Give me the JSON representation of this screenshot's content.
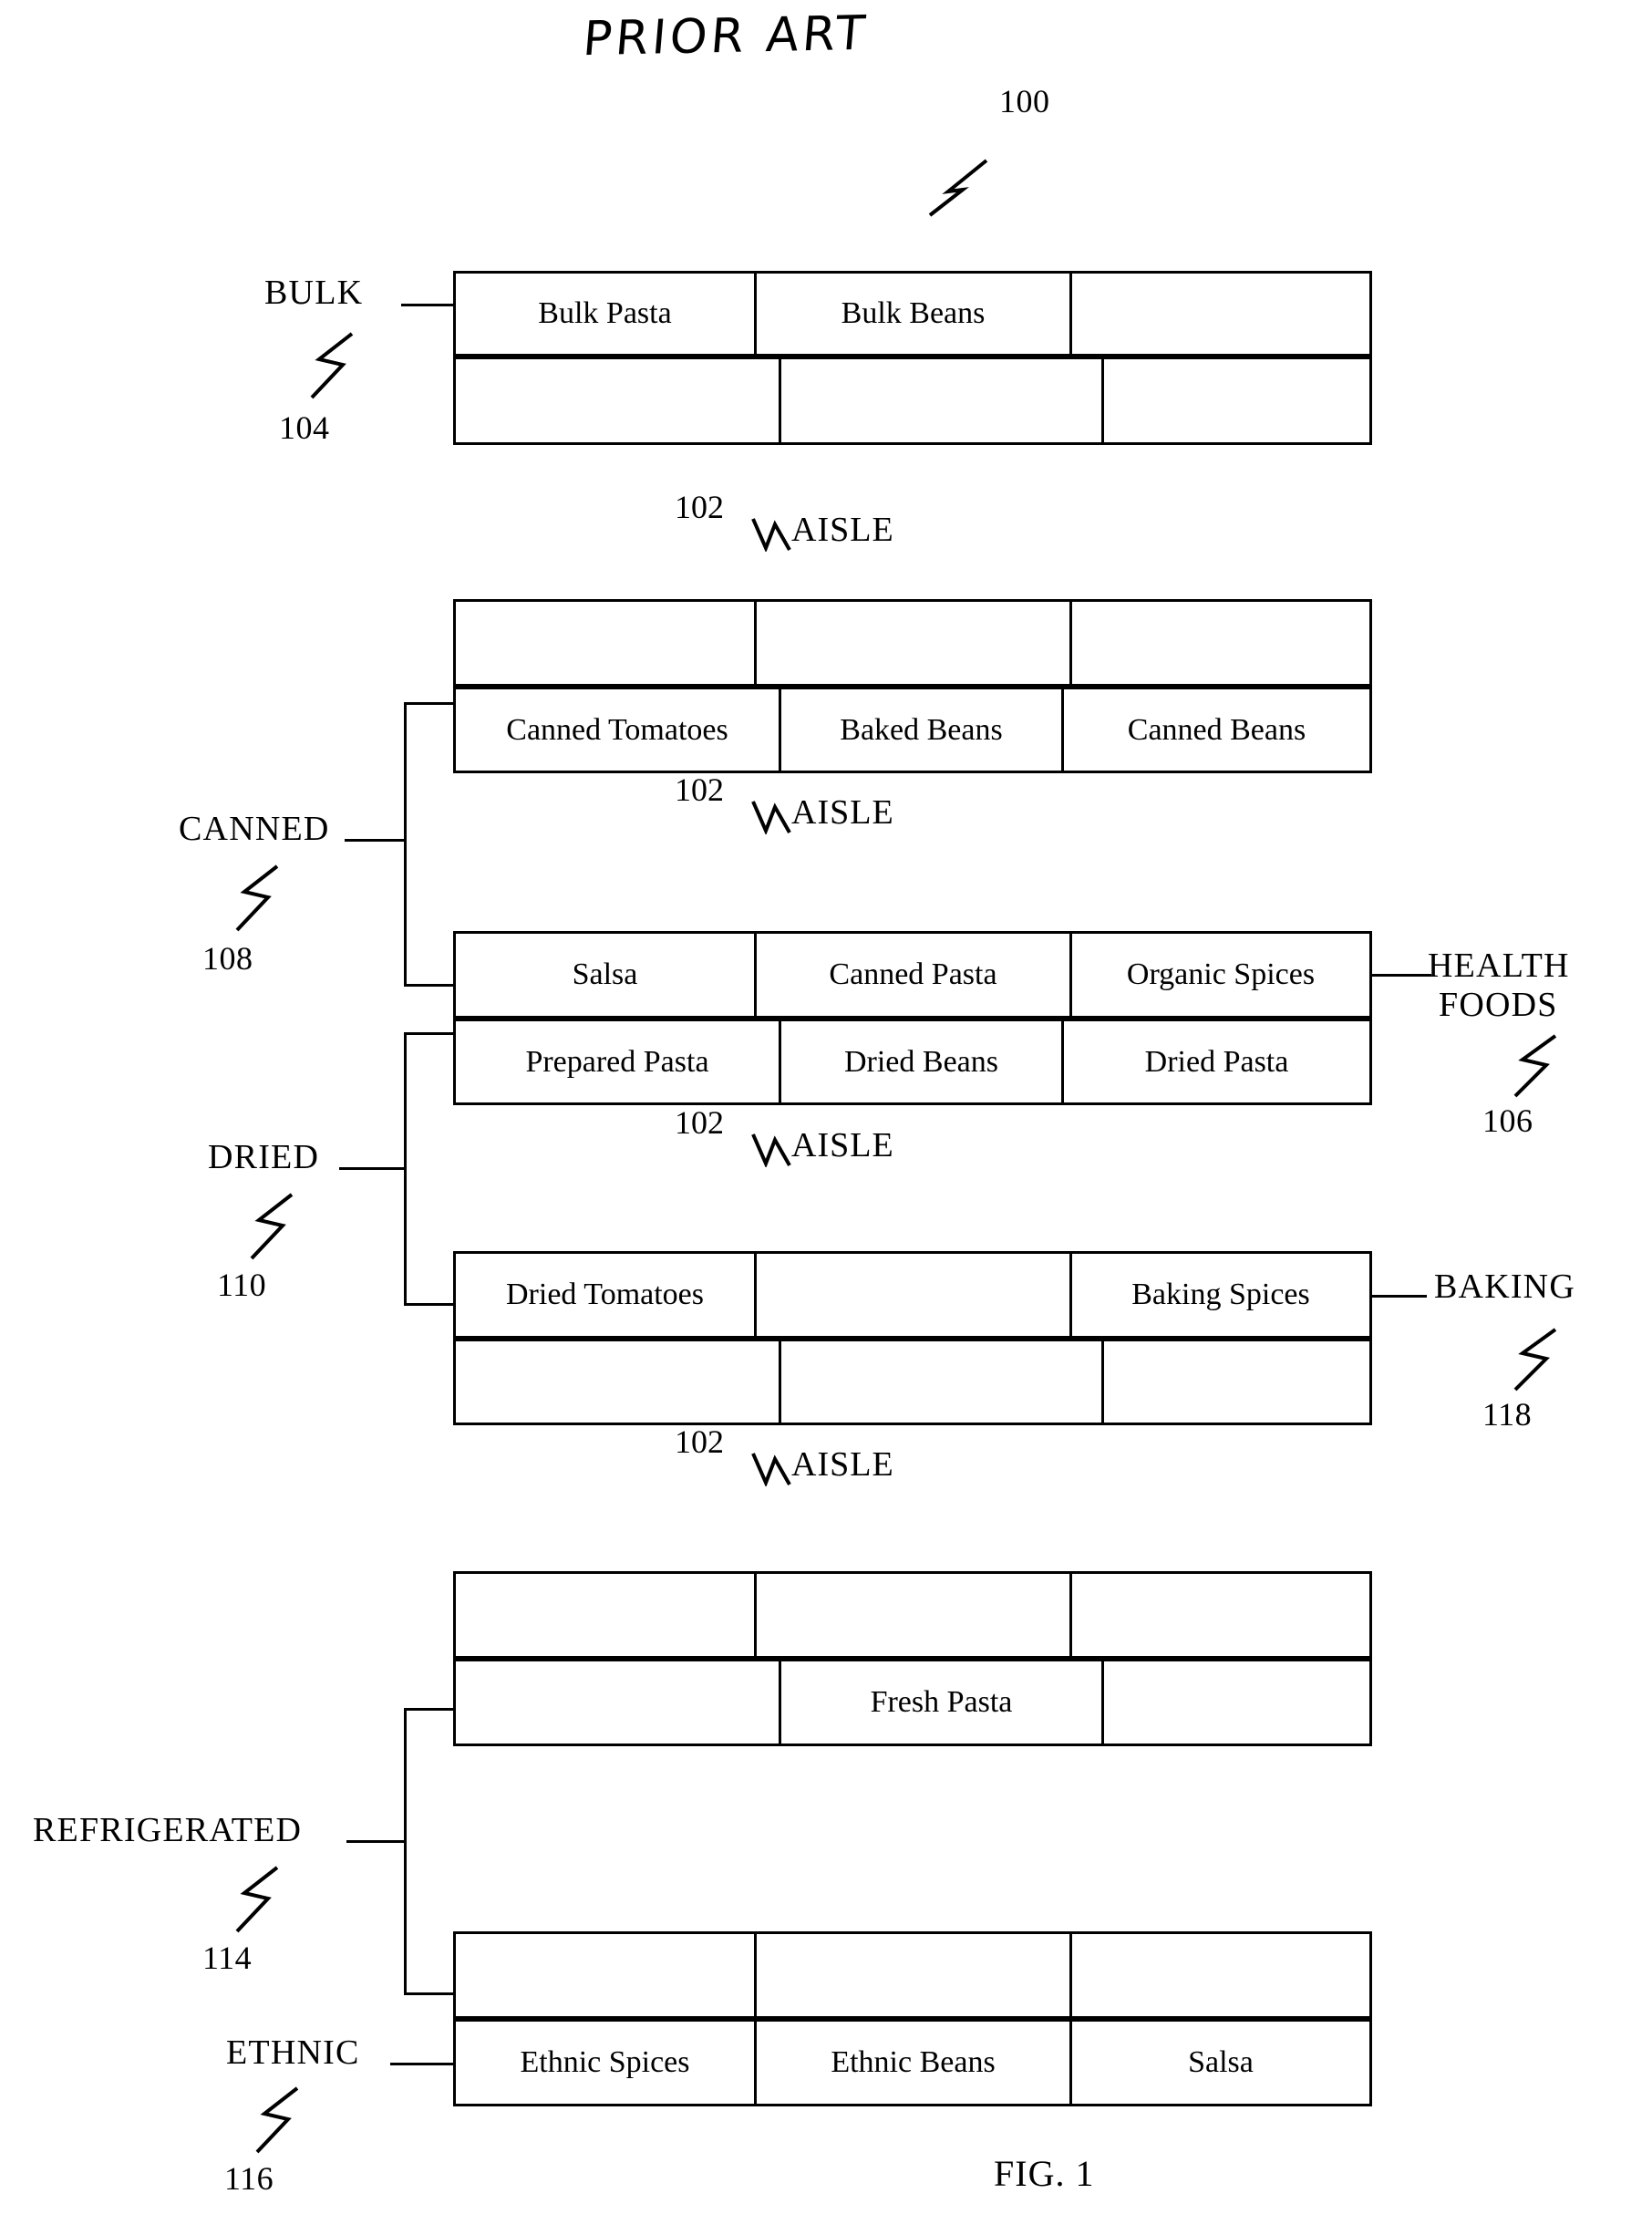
{
  "figure": {
    "prior_art_label": "PRIOR ART",
    "figure_caption": "FIG. 1",
    "system_ref": "100"
  },
  "aisle": {
    "label": "AISLE",
    "ref": "102",
    "count": 4
  },
  "categories": {
    "bulk": {
      "label": "BULK",
      "ref": "104"
    },
    "health_foods": {
      "label_line1": "HEALTH",
      "label_line2": "FOODS",
      "ref": "106"
    },
    "canned": {
      "label": "CANNED",
      "ref": "108"
    },
    "dried": {
      "label": "DRIED",
      "ref": "110"
    },
    "refrigerated": {
      "label": "REFRIGERATED",
      "ref": "114"
    },
    "ethnic": {
      "label": "ETHNIC",
      "ref": "116"
    },
    "baking": {
      "label": "BAKING",
      "ref": "118"
    }
  },
  "shelves": {
    "bulk_unit": {
      "top_row": [
        "Bulk Pasta",
        "Bulk Beans",
        ""
      ],
      "bottom_row": [
        "",
        "",
        ""
      ]
    },
    "canned_unit_1": {
      "top_row": [
        "",
        "",
        ""
      ],
      "bottom_row": [
        "Canned Tomatoes",
        "Baked Beans",
        "Canned Beans"
      ]
    },
    "canned_dried_unit": {
      "top_row": [
        "Salsa",
        "Canned Pasta",
        "Organic Spices"
      ],
      "bottom_row": [
        "Prepared Pasta",
        "Dried Beans",
        "Dried Pasta"
      ]
    },
    "dried_unit_2": {
      "top_row": [
        "Dried Tomatoes",
        "",
        "Baking Spices"
      ],
      "bottom_row": [
        "",
        "",
        ""
      ]
    },
    "refrigerated_unit": {
      "top_row": [
        "",
        "",
        ""
      ],
      "bottom_row": [
        "",
        "Fresh Pasta",
        ""
      ]
    },
    "ethnic_unit": {
      "top_row": [
        "",
        "",
        ""
      ],
      "bottom_row": [
        "Ethnic Spices",
        "Ethnic Beans",
        "Salsa"
      ]
    }
  }
}
